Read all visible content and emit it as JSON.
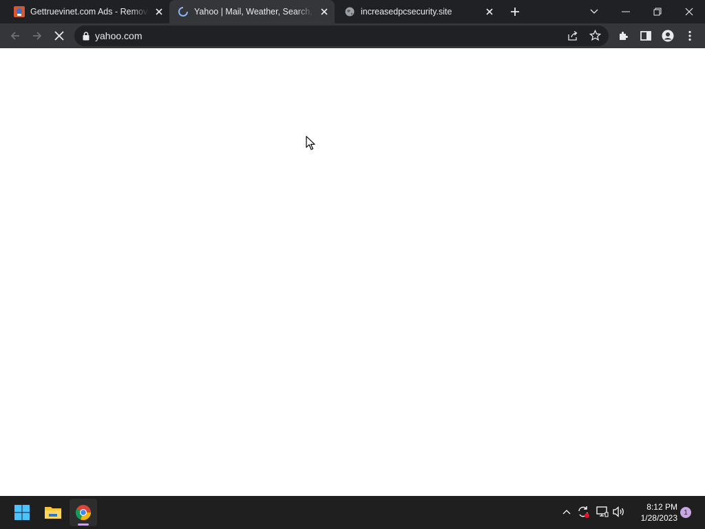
{
  "browser": {
    "tabs": [
      {
        "title": "Gettruevinet.com Ads - Remove",
        "favicon": "site-favicon",
        "active": false
      },
      {
        "title": "Yahoo | Mail, Weather, Search, Po",
        "favicon": "loading-spinner",
        "active": true
      },
      {
        "title": "increasedpcsecurity.site",
        "favicon": "globe-icon",
        "active": false
      }
    ],
    "address": "yahoo.com"
  },
  "taskbar": {
    "time": "8:12 PM",
    "date": "1/28/2023",
    "notification_count": "1"
  },
  "colors": {
    "tabstrip": "#202124",
    "toolbar": "#35363a",
    "taskbar": "#1f1f1f",
    "accent": "#8ab4f8"
  }
}
